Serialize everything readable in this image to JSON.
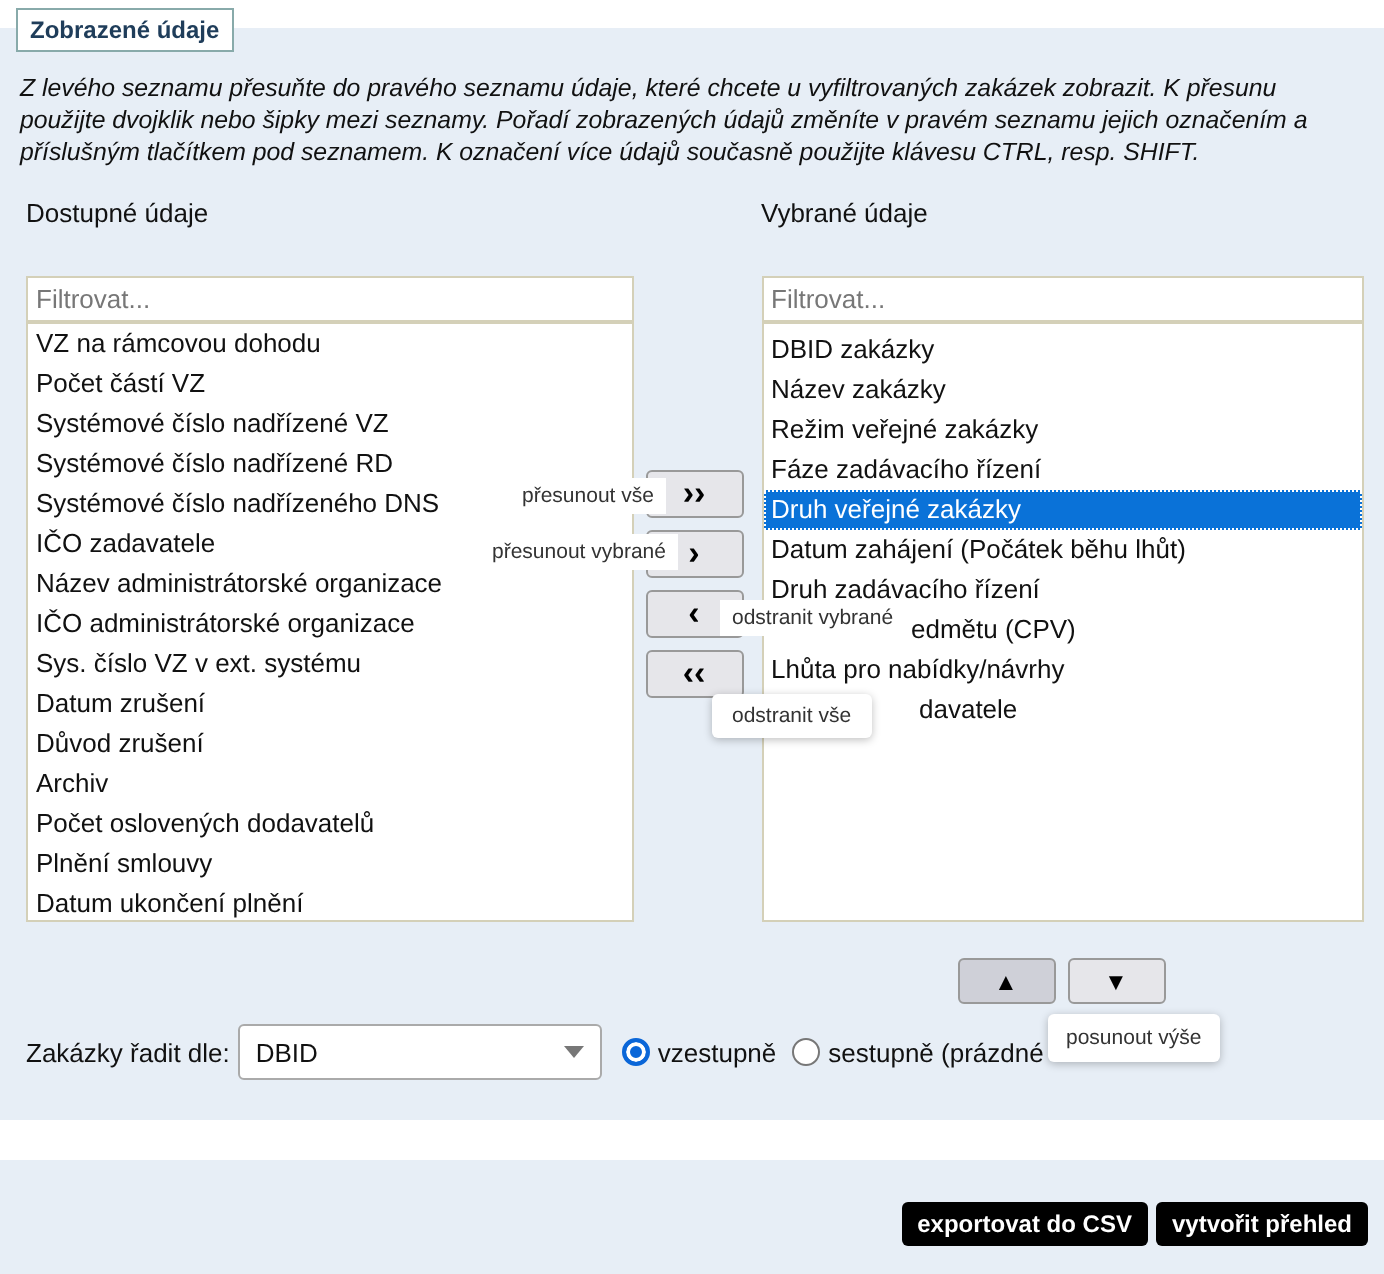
{
  "legend": "Zobrazené údaje",
  "intro": "Z levého seznamu přesuňte do pravého seznamu údaje, které chcete u vyfiltrovaných zakázek zobrazit. K přesunu použijte dvojklik nebo šipky mezi seznamy. Pořadí zobrazených údajů změníte v pravém seznamu jejich označením a příslušným tlačítkem pod seznamem. K označení více údajů současně použijte klávesu CTRL, resp. SHIFT.",
  "available": {
    "label": "Dostupné údaje",
    "placeholder": "Filtrovat...",
    "items": [
      {
        "text": "VZ na rámcovou dohodu",
        "selected": false
      },
      {
        "text": "Počet částí VZ",
        "selected": false
      },
      {
        "text": "Systémové číslo nadřízené VZ",
        "selected": false
      },
      {
        "text": "Systémové číslo nadřízené RD",
        "selected": false
      },
      {
        "text": "Systémové číslo nadřízeného DNS",
        "selected": false
      },
      {
        "text": "IČO zadavatele",
        "selected": false
      },
      {
        "text": "Název administrátorské organizace",
        "selected": false
      },
      {
        "text": "IČO administrátorské organizace",
        "selected": false
      },
      {
        "text": "Sys. číslo VZ v ext. systému",
        "selected": false
      },
      {
        "text": "Datum zrušení",
        "selected": false
      },
      {
        "text": "Důvod zrušení",
        "selected": false
      },
      {
        "text": "Archiv",
        "selected": false
      },
      {
        "text": "Počet oslovených dodavatelů",
        "selected": false
      },
      {
        "text": "Plnění smlouvy",
        "selected": false
      },
      {
        "text": "Datum ukončení plnění",
        "selected": false
      }
    ]
  },
  "transfer_buttons": [
    {
      "symbol": "››",
      "tooltip": "přesunout vše"
    },
    {
      "symbol": "›",
      "tooltip": "přesunout vybrané"
    },
    {
      "symbol": "‹",
      "tooltip": "odstranit vybrané"
    },
    {
      "symbol": "‹‹",
      "tooltip": "odstranit vše"
    }
  ],
  "selected_list": {
    "label": "Vybrané údaje",
    "placeholder": "Filtrovat...",
    "items": [
      {
        "text": "DBID zakázky",
        "selected": false,
        "kind": "plain"
      },
      {
        "text": "Název zakázky",
        "selected": false,
        "kind": "plain"
      },
      {
        "text": "Režim veřejné zakázky",
        "selected": false,
        "kind": "plain"
      },
      {
        "text": "Fáze zadávacího řízení",
        "selected": false,
        "kind": "plain"
      },
      {
        "text": "Druh veřejné zakázky",
        "selected": true,
        "kind": "plain"
      },
      {
        "text": "Datum zahájení (Počátek běhu lhůt)",
        "selected": false,
        "kind": "plain"
      },
      {
        "text": "Druh zadávacího řízení",
        "selected": false,
        "kind": "plain"
      },
      {
        "text": "edmětu (CPV)",
        "selected": false,
        "kind": "covered"
      },
      {
        "text": "Lhůta pro nabídky/návrhy",
        "selected": false,
        "kind": "plain"
      },
      {
        "text": "davatele",
        "selected": false,
        "kind": "covered-wide"
      }
    ]
  },
  "order_buttons": [
    {
      "symbol": "▲",
      "active": true
    },
    {
      "symbol": "▼",
      "active": false
    }
  ],
  "order_tooltip": "posunout výše",
  "sort": {
    "label": "Zakázky řadit dle:",
    "value": "DBID",
    "options": [
      {
        "label": "vzestupně",
        "selected": true
      },
      {
        "label": "sestupně (prázdné",
        "selected": false
      }
    ]
  },
  "actions": [
    "exportovat do CSV",
    "vytvořit přehled"
  ]
}
